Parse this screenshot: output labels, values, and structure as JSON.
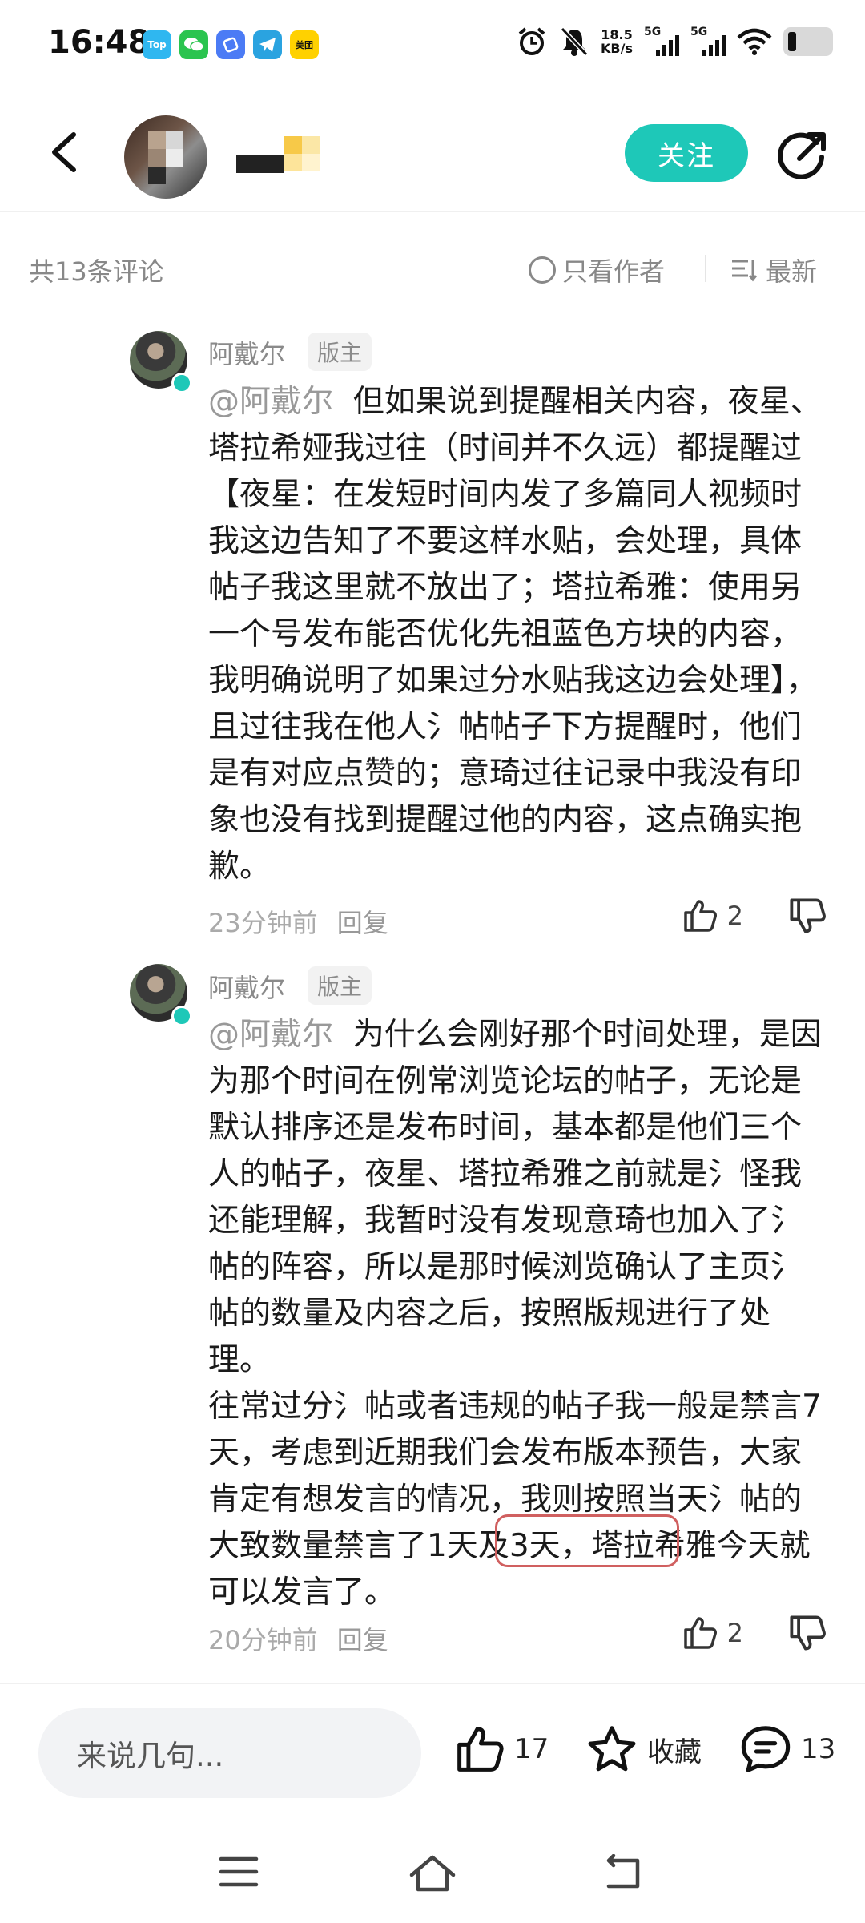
{
  "status_bar": {
    "time": "16:48",
    "apps": [
      {
        "icon": "top-app-icon",
        "label": "Top",
        "color": "#2fb7f0"
      },
      {
        "icon": "wechat-icon",
        "label": "",
        "color": "#2bc44f"
      },
      {
        "icon": "browser-icon",
        "label": "",
        "color": "#4b7bf5"
      },
      {
        "icon": "telegram-icon",
        "label": "",
        "color": "#2aa3e0"
      },
      {
        "icon": "meituan-icon",
        "label": "美团",
        "color": "#ffd100"
      }
    ],
    "net_speed": "18.5",
    "net_unit": "KB/s",
    "sim1": "5G",
    "sim2": "5G"
  },
  "header": {
    "follow_label": "关注"
  },
  "comment_bar": {
    "count_label": "共13条评论",
    "only_author_label": "只看作者",
    "sort_label": "最新"
  },
  "comments": [
    {
      "author": "阿戴尔",
      "badge": "版主",
      "mention": "@阿戴尔",
      "text": "  但如果说到提醒相关内容，夜星、塔拉希娅我过往（时间并不久远）都提醒过【夜星：在发短时间内发了多篇同人视频时我这边告知了不要这样水贴，会处理，具体帖子我这里就不放出了；塔拉希雅：使用另一个号发布能否优化先祖蓝色方块的内容，我明确说明了如果过分水贴我这边会处理】，且过往我在他人氵帖帖子下方提醒时，他们是有对应点赞的；意琦过往记录中我没有印象也没有找到提醒过他的内容，这点确实抱歉。",
      "time": "23分钟前",
      "reply_label": "回复",
      "likes": "2"
    },
    {
      "author": "阿戴尔",
      "badge": "版主",
      "mention": "@阿戴尔",
      "text": "  为什么会刚好那个时间处理，是因为那个时间在例常浏览论坛的帖子，无论是默认排序还是发布时间，基本都是他们三个人的帖子，夜星、塔拉希雅之前就是氵怪我还能理解，我暂时没有发现意琦也加入了氵帖的阵容，所以是那时候浏览确认了主页氵帖的数量及内容之后，按照版规进行了处理。\n往常过分氵帖或者违规的帖子我一般是禁言7天，考虑到近期我们会发布版本预告，大家肯定有想发言的情况，我则按照当天氵帖的大致数量禁言了1天及3天，塔拉希雅今天就可以发言了。",
      "time": "20分钟前",
      "reply_label": "回复",
      "likes": "2"
    }
  ],
  "bottom_bar": {
    "input_placeholder": "来说几句...",
    "like_count": "17",
    "favorite_label": "收藏",
    "comment_count": "13"
  },
  "colors": {
    "accent": "#1ec8b8",
    "highlight_box": "#d06060"
  }
}
